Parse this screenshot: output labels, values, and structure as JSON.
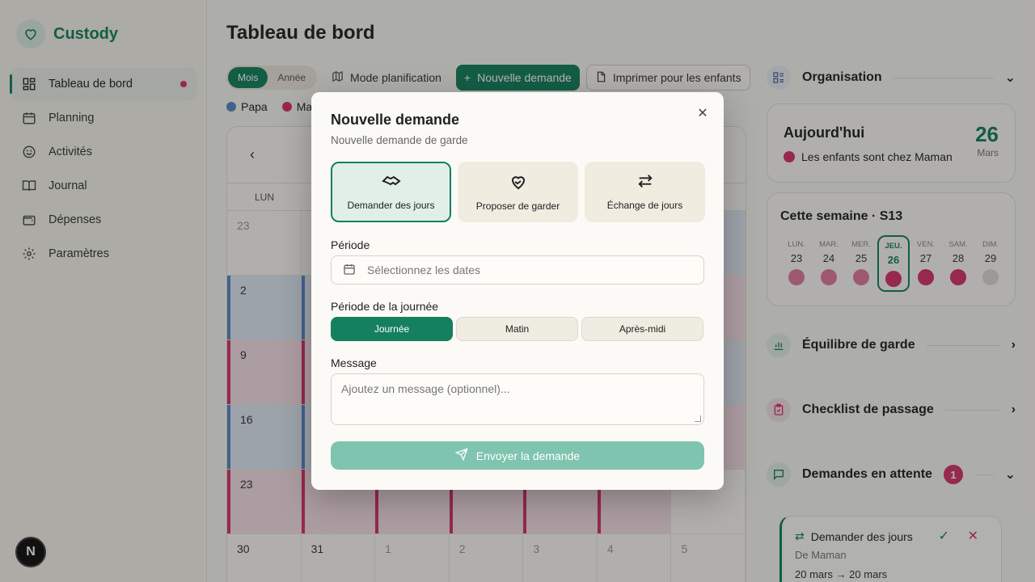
{
  "app": {
    "name": "Custody"
  },
  "sidebar": {
    "items": [
      {
        "label": "Tableau de bord"
      },
      {
        "label": "Planning"
      },
      {
        "label": "Activités"
      },
      {
        "label": "Journal"
      },
      {
        "label": "Dépenses"
      },
      {
        "label": "Paramètres"
      }
    ],
    "avatar_letter": "N"
  },
  "main": {
    "title": "Tableau de bord",
    "toolbar": {
      "view_month": "Mois",
      "view_year": "Année",
      "planning_mode": "Mode planification",
      "new_request": "Nouvelle demande",
      "print": "Imprimer pour les enfants"
    },
    "legend": {
      "papa": "Papa",
      "maman": "Ma"
    },
    "calendar": {
      "first_day_label": "LUN",
      "rows": [
        [
          "23"
        ],
        [
          "2"
        ],
        [
          "9"
        ],
        [
          "16"
        ],
        [
          "23"
        ],
        [
          "30",
          "31",
          "1",
          "2",
          "3",
          "4",
          "5"
        ]
      ]
    }
  },
  "right_panel": {
    "organisation": "Organisation",
    "today": {
      "title": "Aujourd'hui",
      "status": "Les enfants sont chez Maman",
      "day": "26",
      "month": "Mars"
    },
    "week": {
      "title": "Cette semaine · S13",
      "days": [
        {
          "label": "LUN.",
          "num": "23"
        },
        {
          "label": "MAR.",
          "num": "24"
        },
        {
          "label": "MER.",
          "num": "25"
        },
        {
          "label": "JEU.",
          "num": "26"
        },
        {
          "label": "VEN.",
          "num": "27"
        },
        {
          "label": "SAM.",
          "num": "28"
        },
        {
          "label": "DIM.",
          "num": "29"
        }
      ]
    },
    "balance": "Équilibre de garde",
    "checklist": "Checklist de passage",
    "pending": {
      "title": "Demandes en attente",
      "count": "1"
    },
    "request": {
      "type": "Demander des jours",
      "from": "De Maman",
      "dates": "20 mars → 20 mars"
    }
  },
  "modal": {
    "title": "Nouvelle demande",
    "subtitle": "Nouvelle demande de garde",
    "types": [
      {
        "label": "Demander des jours"
      },
      {
        "label": "Proposer de garder"
      },
      {
        "label": "Échange de jours"
      }
    ],
    "period_label": "Période",
    "period_placeholder": "Sélectionnez les dates",
    "day_period_label": "Période de la journée",
    "slots": [
      {
        "label": "Journée"
      },
      {
        "label": "Matin"
      },
      {
        "label": "Après-midi"
      }
    ],
    "message_label": "Message",
    "message_placeholder": "Ajoutez un message (optionnel)...",
    "send": "Envoyer la demande"
  },
  "colors": {
    "accent": "#15805e",
    "papa": "#5b86c9",
    "maman": "#d6336c"
  }
}
